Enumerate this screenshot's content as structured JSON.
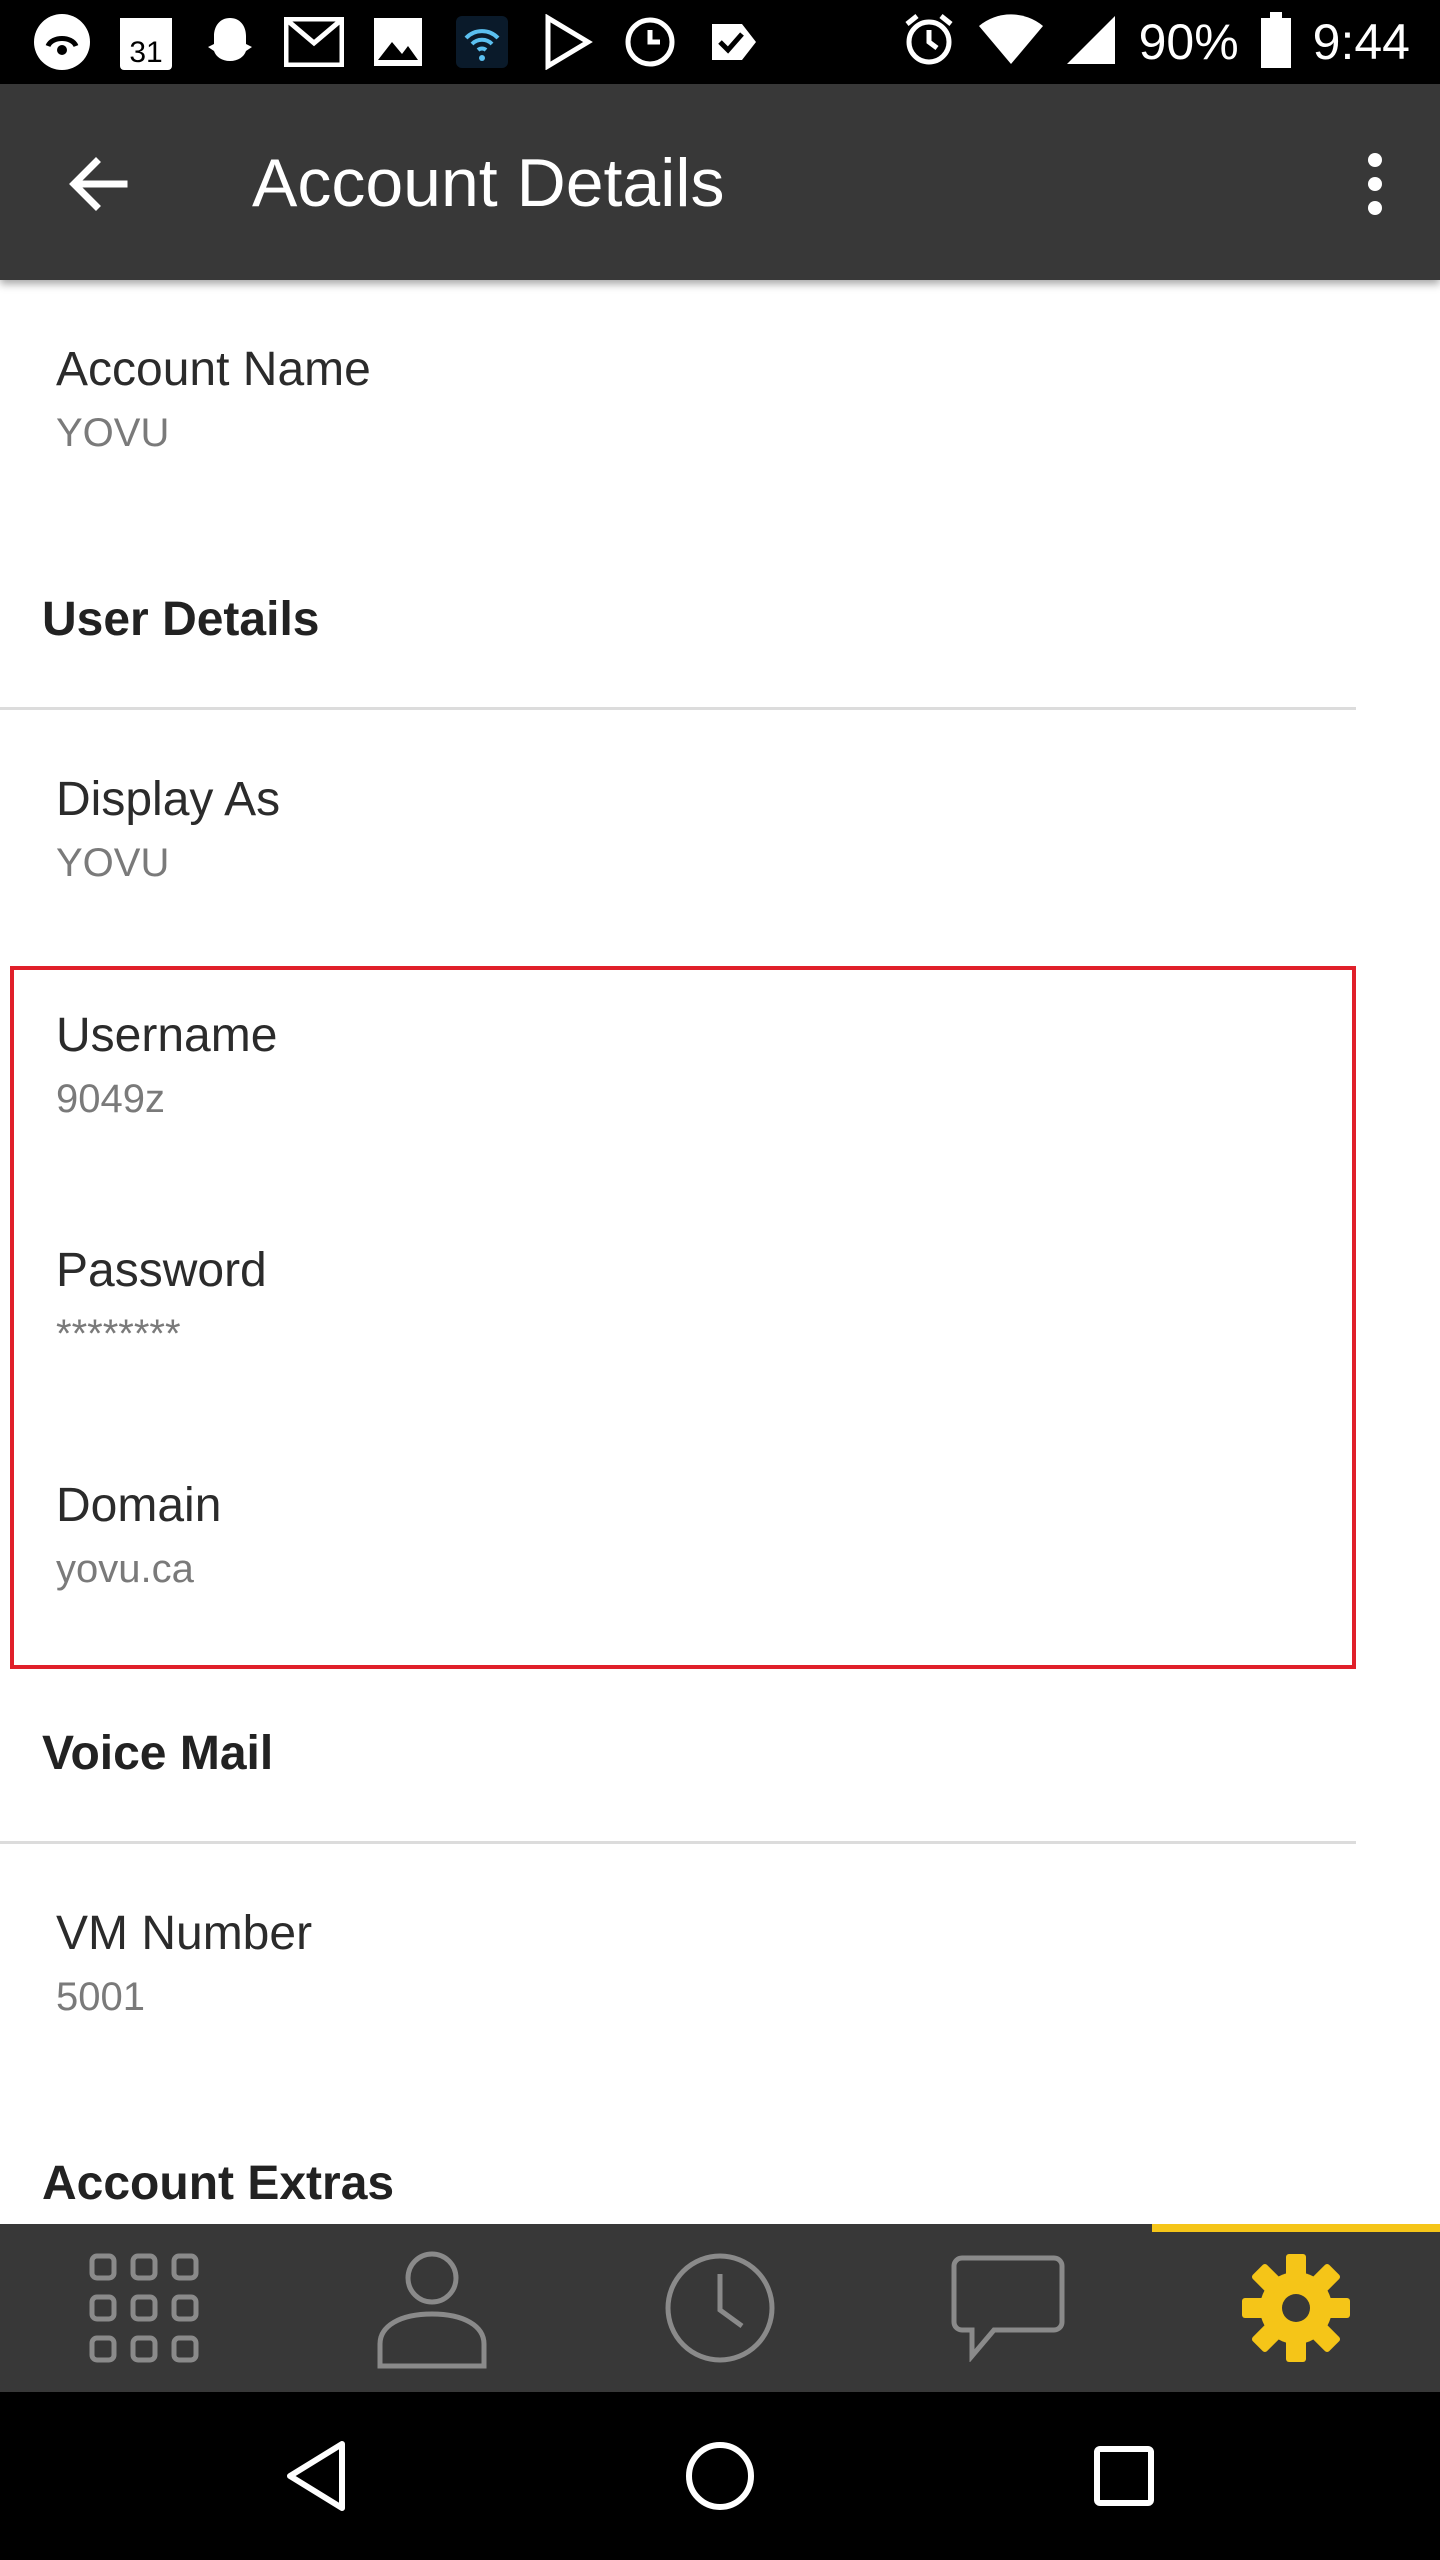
{
  "status_bar": {
    "battery": "90%",
    "time": "9:44",
    "calendar_day": "31",
    "left_icons": [
      "snapchat-ghost-icon",
      "calendar-icon",
      "snapchat-icon",
      "gmail-icon",
      "gallery-icon",
      "wifi-calling-icon",
      "play-icon",
      "clock-icon",
      "check-icon"
    ],
    "right_icons": [
      "alarm-icon",
      "wifi-icon",
      "signal-icon",
      "battery-icon"
    ]
  },
  "toolbar": {
    "title": "Account Details",
    "back_icon": "back-arrow-icon",
    "menu_icon": "overflow-menu-icon"
  },
  "fields": {
    "account_name": {
      "label": "Account Name",
      "value": "YOVU"
    },
    "display_as": {
      "label": "Display As",
      "value": "YOVU"
    },
    "username": {
      "label": "Username",
      "value": "9049z"
    },
    "password": {
      "label": "Password",
      "value": "********"
    },
    "domain": {
      "label": "Domain",
      "value": "yovu.ca"
    },
    "vm_number": {
      "label": "VM Number",
      "value": "5001"
    }
  },
  "sections": {
    "user_details": "User Details",
    "voice_mail": "Voice Mail",
    "account_extras": "Account Extras"
  },
  "tabs": [
    {
      "name": "dialpad",
      "icon": "dialpad-icon",
      "active": false
    },
    {
      "name": "contacts",
      "icon": "contact-icon",
      "active": false
    },
    {
      "name": "history",
      "icon": "clock-icon",
      "active": false
    },
    {
      "name": "messages",
      "icon": "chat-bubble-icon",
      "active": false
    },
    {
      "name": "settings",
      "icon": "gear-icon",
      "active": true
    }
  ],
  "colors": {
    "toolbar": "#383838",
    "accent": "#f5c518",
    "highlight": "#e0202a",
    "icon_inactive": "#8a8a8a"
  },
  "nav": [
    "back-triangle-icon",
    "home-circle-icon",
    "recents-square-icon"
  ]
}
